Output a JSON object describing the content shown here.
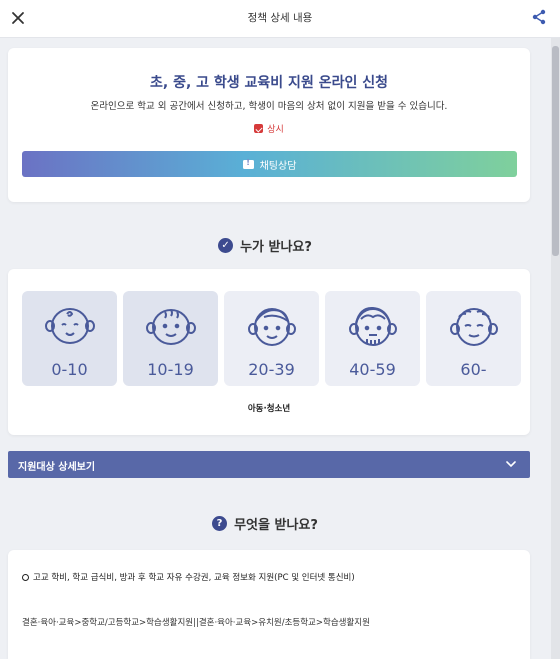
{
  "header": {
    "title": "정책 상세 내용",
    "close_icon": "close-icon",
    "share_icon": "share-icon"
  },
  "summary": {
    "headline": "초, 중, 고 학생 교육비 지원 온라인 신청",
    "description": "온라인으로 학교 외 공간에서 신청하고, 학생이 마음의 상처 없이 지원을 받을 수 있습니다.",
    "period": "상시",
    "chat_button": "채팅상담"
  },
  "who": {
    "title": "누가 받나요?",
    "age_groups": [
      {
        "label": "0-10",
        "icon": "baby-face-icon"
      },
      {
        "label": "10-19",
        "icon": "child-face-icon"
      },
      {
        "label": "20-39",
        "icon": "adult-face-icon"
      },
      {
        "label": "40-59",
        "icon": "middle-aged-face-icon"
      },
      {
        "label": "60-",
        "icon": "senior-face-icon"
      }
    ],
    "active_groups": [
      0,
      1
    ],
    "target_tag": "아동·청소년",
    "details_toggle": "지원대상 상세보기"
  },
  "what": {
    "title": "무엇을 받나요?",
    "benefit": "고교 학비, 학교 급식비, 방과 후 학교 자유 수강권, 교육 정보화 지원(PC 및 인터넷 통신비)",
    "category_path": "결혼·육아·교육>중학교/고등학교>학습생활지원||결혼·육아·교육>유치원/초등학교>학습생활지원"
  },
  "colors": {
    "accent": "#3a4a8c",
    "accordion": "#5868a8",
    "period_red": "#d63a3a",
    "gradient": [
      "#6b72c4",
      "#5ab0d6",
      "#7fd09c"
    ]
  }
}
